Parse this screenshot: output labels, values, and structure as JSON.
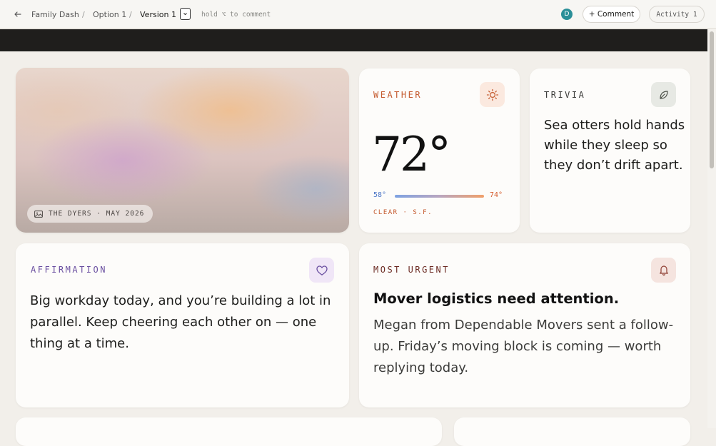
{
  "topbar": {
    "breadcrumb": [
      "Family Dash",
      "Option 1",
      "Version 1"
    ],
    "separator": "/",
    "hint": "hold ⌥ to comment",
    "avatar_initial": "D",
    "comment_label": "+ Comment",
    "activity_label": "Activity 1"
  },
  "photo": {
    "caption": "THE DYERS · MAY 2026"
  },
  "weather": {
    "title": "WEATHER",
    "temperature": "72°",
    "low": "58°",
    "high": "74°",
    "condition": "CLEAR · S.F."
  },
  "trivia": {
    "title": "TRIVIA",
    "text": "Sea otters hold hands while they sleep so they don’t drift apart."
  },
  "affirmation": {
    "title": "AFFIRMATION",
    "text": "Big workday today, and you’re building a lot in parallel. Keep cheering each other on — one thing at a time."
  },
  "urgent": {
    "title": "MOST URGENT",
    "headline": "Mover logistics need attention.",
    "body": "Megan from Dependable Movers sent a follow-up. Friday’s moving block is coming — worth replying today."
  },
  "colors": {
    "weather_accent": "#c45a2e",
    "trivia_accent": "#3a3a38",
    "affirmation_accent": "#6a4fa0",
    "urgent_accent": "#6b2a22",
    "avatar": "#2a8f98"
  },
  "icons": {
    "back": "arrow-left-icon",
    "weather": "sun-icon",
    "trivia": "leaf-icon",
    "affirmation": "heart-icon",
    "urgent": "bell-icon",
    "photo": "image-icon"
  }
}
